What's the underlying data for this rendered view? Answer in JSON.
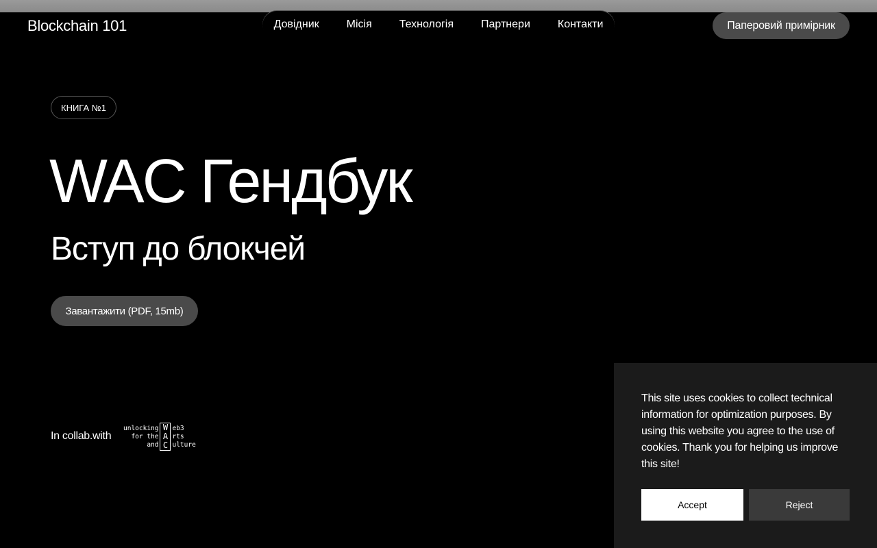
{
  "header": {
    "brand": "Blockchain 101",
    "nav": [
      "Довідник",
      "Місія",
      "Технологія",
      "Партнери",
      "Контакти"
    ],
    "cta": "Паперовий примірник"
  },
  "hero": {
    "badge": "КНИГА №1",
    "title": "WAC Гендбук",
    "subtitle": "Вступ до блокчей",
    "download": "Завантажити (PDF, 15mb)"
  },
  "collab": {
    "label": "In collab.with",
    "logo": {
      "left": [
        "unlocking",
        "for the",
        "and"
      ],
      "box": [
        "W",
        "A",
        "C"
      ],
      "right": [
        "eb3",
        "rts",
        "ulture"
      ]
    }
  },
  "cookie": {
    "text": "This site uses cookies to collect technical information for optimization purposes. By using this website you agree to the use of cookies. Thank you for helping us improve this site!",
    "accept": "Accept",
    "reject": "Reject"
  }
}
